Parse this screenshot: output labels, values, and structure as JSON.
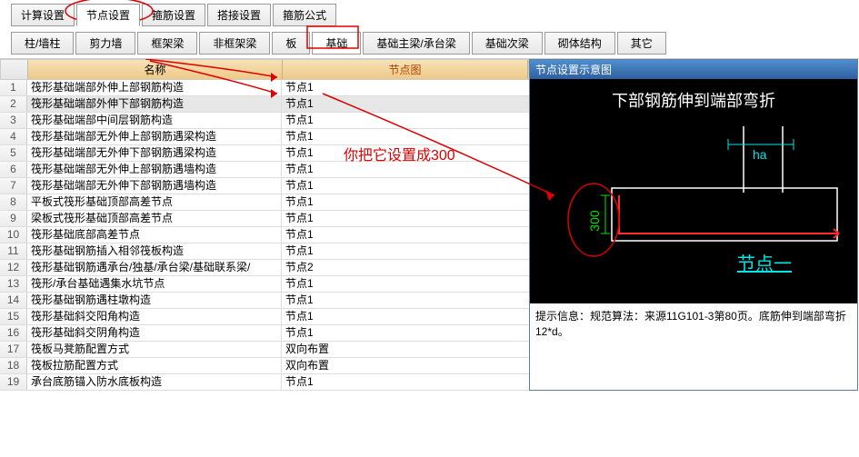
{
  "top_tabs": {
    "t0": "计算设置",
    "t1": "节点设置",
    "t2": "箍筋设置",
    "t3": "搭接设置",
    "t4": "箍筋公式"
  },
  "sec_tabs": {
    "s0": "柱/墙柱",
    "s1": "剪力墙",
    "s2": "框架梁",
    "s3": "非框架梁",
    "s4": "板",
    "s5": "基础",
    "s6": "基础主梁/承台梁",
    "s7": "基础次梁",
    "s8": "砌体结构",
    "s9": "其它"
  },
  "headers": {
    "name": "名称",
    "node": "节点图"
  },
  "rows": [
    {
      "n": "1",
      "name": "筏形基础端部外伸上部钢筋构造",
      "node": "节点1"
    },
    {
      "n": "2",
      "name": "筏形基础端部外伸下部钢筋构造",
      "node": "节点1"
    },
    {
      "n": "3",
      "name": "筏形基础端部中间层钢筋构造",
      "node": "节点1"
    },
    {
      "n": "4",
      "name": "筏形基础端部无外伸上部钢筋遇梁构造",
      "node": "节点1"
    },
    {
      "n": "5",
      "name": "筏形基础端部无外伸下部钢筋遇梁构造",
      "node": "节点1"
    },
    {
      "n": "6",
      "name": "筏形基础端部无外伸上部钢筋遇墙构造",
      "node": "节点1"
    },
    {
      "n": "7",
      "name": "筏形基础端部无外伸下部钢筋遇墙构造",
      "node": "节点1"
    },
    {
      "n": "8",
      "name": "平板式筏形基础顶部高差节点",
      "node": "节点1"
    },
    {
      "n": "9",
      "name": "梁板式筏形基础顶部高差节点",
      "node": "节点1"
    },
    {
      "n": "10",
      "name": "筏形基础底部高差节点",
      "node": "节点1"
    },
    {
      "n": "11",
      "name": "筏形基础钢筋插入相邻筏板构造",
      "node": "节点1"
    },
    {
      "n": "12",
      "name": "筏形基础钢筋遇承台/独基/承台梁/基础联系梁/",
      "node": "节点2"
    },
    {
      "n": "13",
      "name": "筏形/承台基础遇集水坑节点",
      "node": "节点1"
    },
    {
      "n": "14",
      "name": "筏形基础钢筋遇柱墩构造",
      "node": "节点1"
    },
    {
      "n": "15",
      "name": "筏形基础斜交阳角构造",
      "node": "节点1"
    },
    {
      "n": "16",
      "name": "筏形基础斜交阴角构造",
      "node": "节点1"
    },
    {
      "n": "17",
      "name": "筏板马凳筋配置方式",
      "node": "双向布置"
    },
    {
      "n": "18",
      "name": "筏板拉筋配置方式",
      "node": "双向布置"
    },
    {
      "n": "19",
      "name": "承台底筋锚入防水底板构造",
      "node": "节点1"
    }
  ],
  "diagram": {
    "title_bar": "节点设置示意图",
    "title_text": "下部钢筋伸到端部弯折",
    "ha_label": "ha",
    "dim_label": "300",
    "footer": "节点一",
    "hint": "提示信息：规范算法：来源11G101-3第80页。底筋伸到端部弯折12*d。"
  },
  "annotation": {
    "text": "你把它设置成300"
  }
}
